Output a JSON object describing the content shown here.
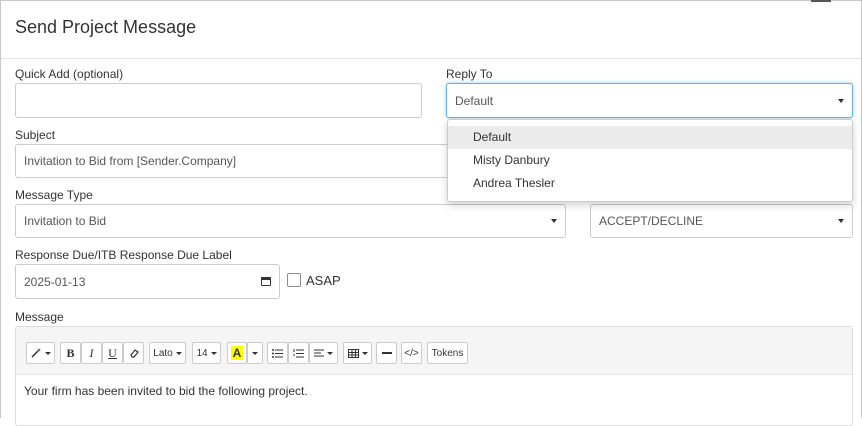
{
  "modal": {
    "title": "Send Project Message"
  },
  "quick_add": {
    "label": "Quick Add (optional)",
    "value": ""
  },
  "reply_to": {
    "label": "Reply To",
    "value": "Default",
    "options": [
      "Default",
      "Misty Danbury",
      "Andrea Thesler"
    ]
  },
  "subject": {
    "label": "Subject",
    "value": "Invitation to Bid from [Sender.Company]"
  },
  "message_type": {
    "label": "Message Type",
    "value": "Invitation to Bid"
  },
  "response_type": {
    "value": "ACCEPT/DECLINE"
  },
  "due": {
    "label": "Response Due/ITB Response Due Label",
    "value": "2025-01-13",
    "asap_label": "ASAP"
  },
  "message": {
    "label": "Message",
    "toolbar": {
      "font": "Lato",
      "size": "14",
      "color_letter": "A",
      "tokens": "Tokens",
      "bold": "B",
      "italic": "I",
      "underline": "U",
      "code": "</>"
    },
    "body": "Your firm has been invited to bid the following project."
  },
  "colors": {
    "accent_focus": "#66afe9",
    "highlight": "#ffff00"
  }
}
